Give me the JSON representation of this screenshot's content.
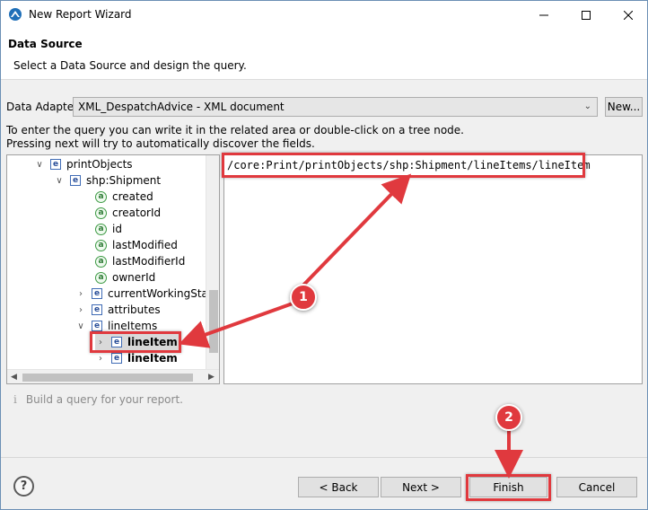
{
  "window": {
    "title": "New Report Wizard"
  },
  "header": {
    "title": "Data Source",
    "description": "Select a Data Source and design the query."
  },
  "adapter": {
    "label": "Data Adapter",
    "value": "XML_DespatchAdvice - XML document",
    "new_button": "New..."
  },
  "info": {
    "line1": "To enter the query you can write it in the related area or double-click on a tree node.",
    "line2": "Pressing next will try to automatically discover the fields."
  },
  "tree": {
    "items": [
      {
        "label": "printObjects"
      },
      {
        "label": "shp:Shipment"
      },
      {
        "label": "created"
      },
      {
        "label": "creatorId"
      },
      {
        "label": "id"
      },
      {
        "label": "lastModified"
      },
      {
        "label": "lastModifierId"
      },
      {
        "label": "ownerId"
      },
      {
        "label": "currentWorkingStat"
      },
      {
        "label": "attributes"
      },
      {
        "label": "lineItems"
      },
      {
        "label": "lineItem"
      },
      {
        "label": "lineItem"
      }
    ]
  },
  "query": {
    "text": "/core:Print/printObjects/shp:Shipment/lineItems/lineItem"
  },
  "status": {
    "text": "Build a query for your report."
  },
  "buttons": {
    "back": "< Back",
    "next": "Next >",
    "finish": "Finish",
    "cancel": "Cancel",
    "help": "?"
  },
  "annotations": {
    "badge1": "1",
    "badge2": "2",
    "color": "#e0393e"
  }
}
